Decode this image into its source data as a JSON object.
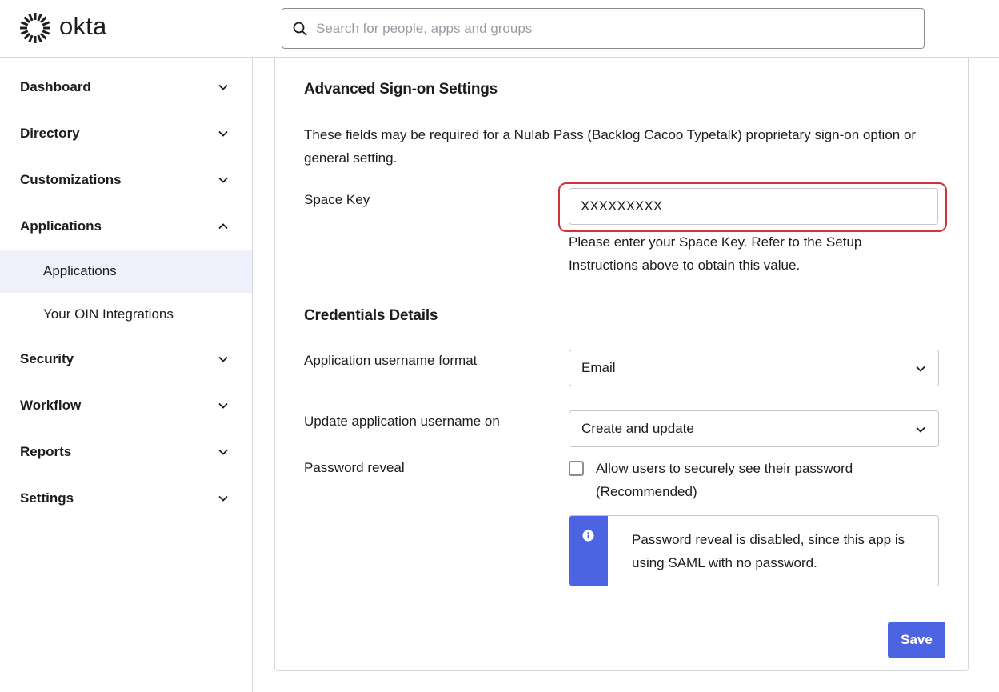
{
  "header": {
    "logo_text": "okta",
    "search_placeholder": "Search for people, apps and groups"
  },
  "sidebar": {
    "items": [
      {
        "label": "Dashboard",
        "expanded": false
      },
      {
        "label": "Directory",
        "expanded": false
      },
      {
        "label": "Customizations",
        "expanded": false
      },
      {
        "label": "Applications",
        "expanded": true
      },
      {
        "label": "Security",
        "expanded": false
      },
      {
        "label": "Workflow",
        "expanded": false
      },
      {
        "label": "Reports",
        "expanded": false
      },
      {
        "label": "Settings",
        "expanded": false
      }
    ],
    "applications_sub": [
      {
        "label": "Applications",
        "active": true
      },
      {
        "label": "Your OIN Integrations",
        "active": false
      }
    ]
  },
  "main": {
    "advanced_title": "Advanced Sign-on Settings",
    "advanced_desc": "These fields may be required for a Nulab Pass (Backlog Cacoo Typetalk) proprietary sign-on option or general setting.",
    "space_key_label": "Space Key",
    "space_key_value": "XXXXXXXXX",
    "space_key_help": "Please enter your Space Key. Refer to the Setup Instructions above to obtain this value.",
    "credentials_title": "Credentials Details",
    "username_format_label": "Application username format",
    "username_format_value": "Email",
    "update_username_label": "Update application username on",
    "update_username_value": "Create and update",
    "password_reveal_label": "Password reveal",
    "password_reveal_checkbox_label": "Allow users to securely see their password (Recommended)",
    "password_reveal_checked": false,
    "callout_text": "Password reveal is disabled, since this app is using SAML with no password.",
    "save_label": "Save"
  },
  "colors": {
    "accent": "#4c64e1",
    "highlight_border": "#d0323b",
    "active_nav_bg": "#eef0fb"
  }
}
